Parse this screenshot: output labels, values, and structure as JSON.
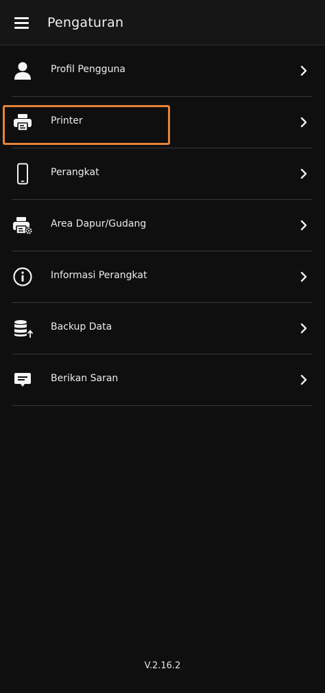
{
  "header": {
    "title": "Pengaturan",
    "menu_icon": "hamburger-menu-icon"
  },
  "menu": {
    "items": [
      {
        "label": "Profil Pengguna",
        "icon": "user-icon"
      },
      {
        "label": "Printer",
        "icon": "printer-icon"
      },
      {
        "label": "Perangkat",
        "icon": "smartphone-icon"
      },
      {
        "label": "Area Dapur/Gudang",
        "icon": "printer-settings-icon"
      },
      {
        "label": "Informasi Perangkat",
        "icon": "info-icon"
      },
      {
        "label": "Backup Data",
        "icon": "database-upload-icon"
      },
      {
        "label": "Berikan Saran",
        "icon": "feedback-icon"
      }
    ],
    "chevron_icon": "chevron-right-icon"
  },
  "footer": {
    "version": "V.2.16.2"
  },
  "colors": {
    "background": "#0f0f0f",
    "header": "#161616",
    "highlight": "#e8843a",
    "divider": "#3a3a3a",
    "text": "#ececec"
  }
}
